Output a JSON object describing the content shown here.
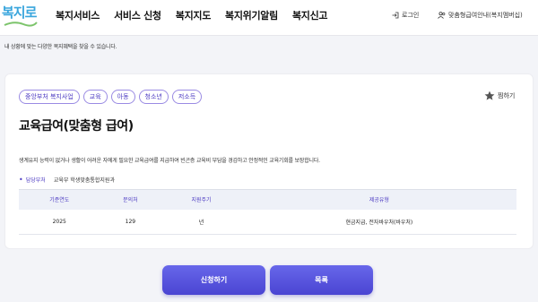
{
  "header": {
    "logo_text": "복지로",
    "nav": [
      "복지서비스",
      "서비스 신청",
      "복지지도",
      "복지위기알림",
      "복지신고"
    ],
    "login": "로그인",
    "guide": "맞춤형급여안내(복지멤버십)"
  },
  "subtitle": "내 상황에 맞는 다양한 복지혜택을 찾을 수 있습니다.",
  "card": {
    "tags": [
      "중앙부처 복지사업",
      "교육",
      "아동",
      "청소년",
      "저소득"
    ],
    "favorite": "찜하기",
    "title": "교육급여(맞춤형 급여)",
    "description": "생계유지 능력이 없거나 생활이 어려운 자에게 필요한 교육급여를 지급하여 빈곤층 교육비 부담을 경감하고 안정적인 교육기회를 보장합니다.",
    "dept_label": "담당부처",
    "dept_value": "교육부 학생맞춤통합지원과",
    "table": {
      "headers": [
        "기준연도",
        "문의처",
        "지원주기",
        "제공유형"
      ],
      "rows": [
        [
          "2025",
          "129",
          "년",
          "현금지급, 전자바우처(바우처)"
        ]
      ]
    }
  },
  "buttons": {
    "apply": "신청하기",
    "list": "목록"
  },
  "colors": {
    "accent": "#4b39c2",
    "button": "#5a55e0",
    "logo": "#3aa6dd"
  }
}
